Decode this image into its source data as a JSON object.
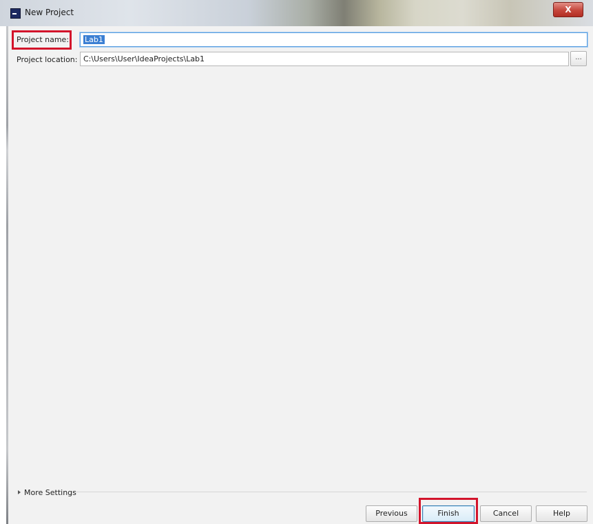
{
  "window": {
    "title": "New Project",
    "close_label": "X"
  },
  "form": {
    "project_name_label": "Project name:",
    "project_name_value": "Lab1",
    "project_location_label": "Project location:",
    "project_location_value": "C:\\Users\\User\\IdeaProjects\\Lab1",
    "browse_label": "..."
  },
  "more_settings_label": "More Settings",
  "buttons": {
    "previous": "Previous",
    "finish": "Finish",
    "cancel": "Cancel",
    "help": "Help"
  },
  "colors": {
    "highlight": "#d3142b",
    "selection": "#3b7fd3",
    "dialog_background": "#f2f2f2"
  },
  "icons": {
    "app": "intellij-idea-icon",
    "close": "close-icon",
    "expand": "triangle-right-icon"
  }
}
